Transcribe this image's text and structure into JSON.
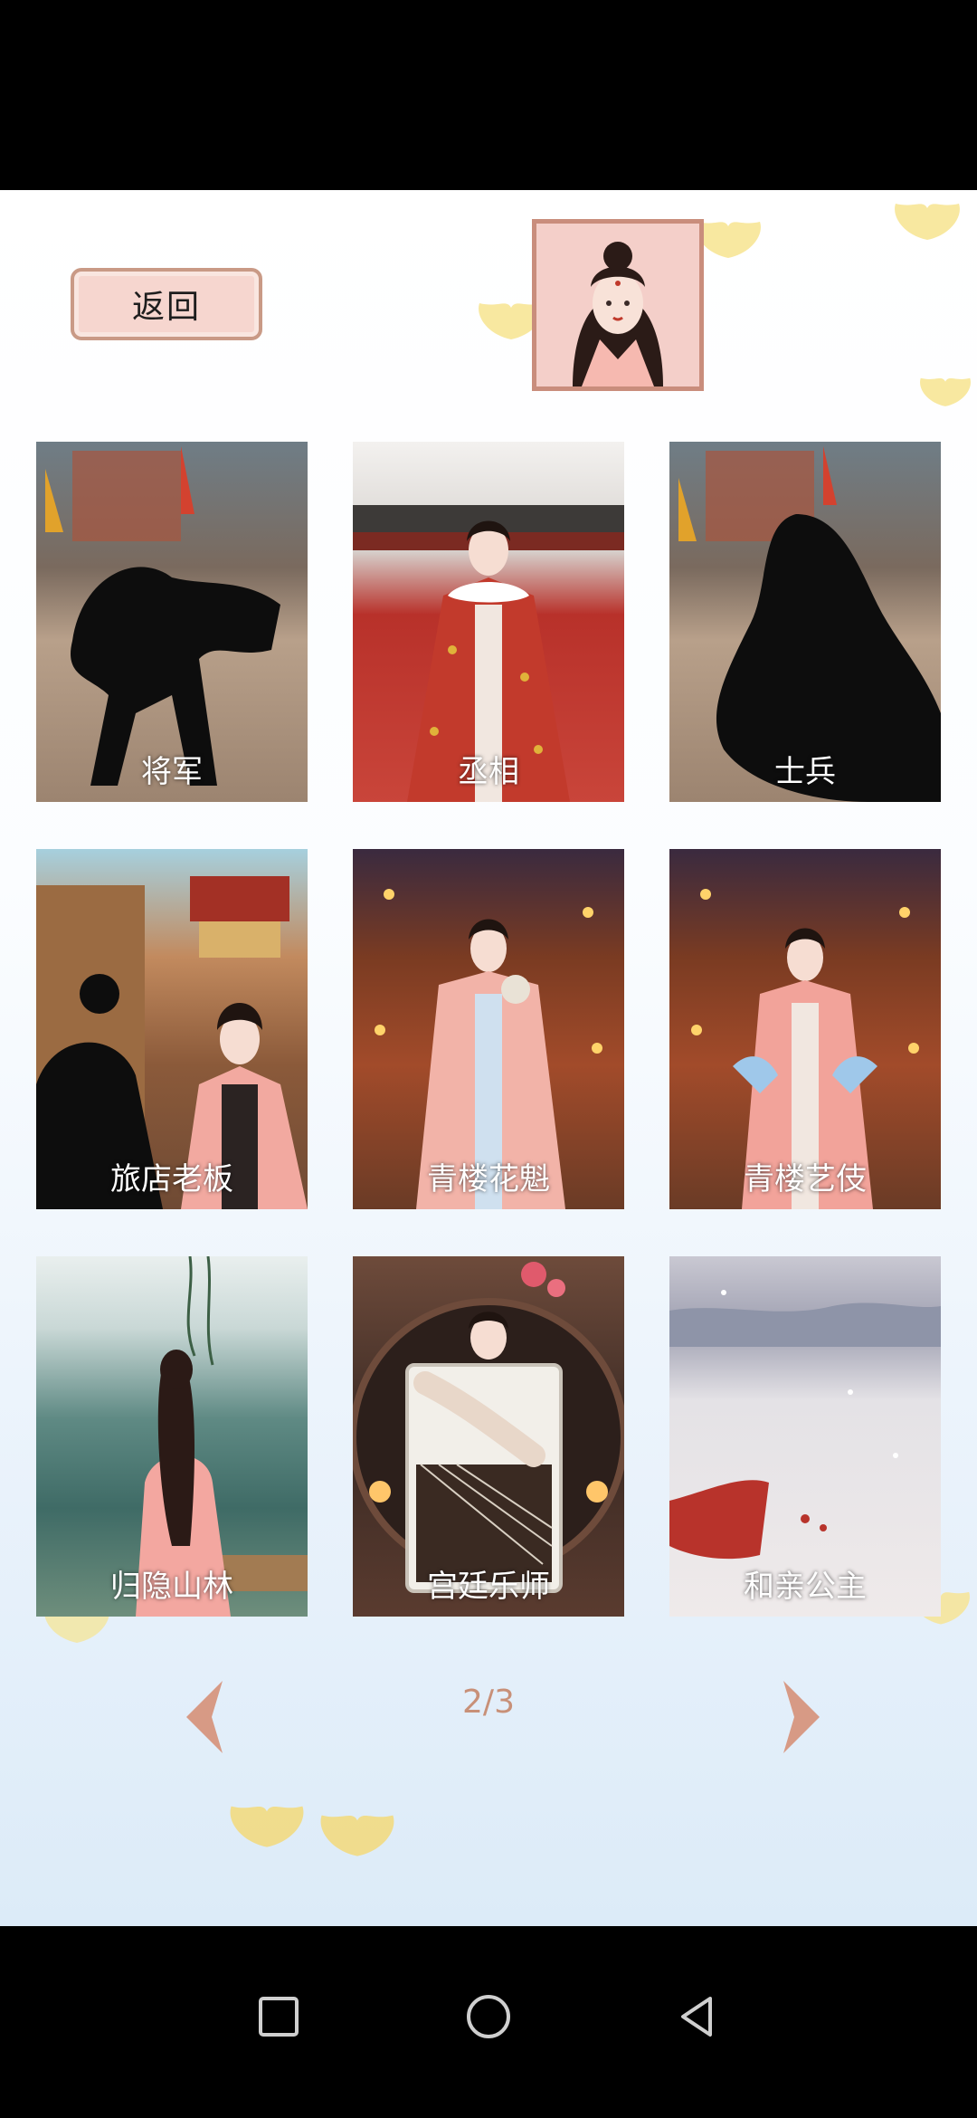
{
  "header": {
    "back_label": "返回"
  },
  "characters": [
    {
      "label": "将军"
    },
    {
      "label": "丞相"
    },
    {
      "label": "士兵"
    },
    {
      "label": "旅店老板"
    },
    {
      "label": "青楼花魁"
    },
    {
      "label": "青楼艺伎"
    },
    {
      "label": "归隐山林"
    },
    {
      "label": "宫廷乐师"
    },
    {
      "label": "和亲公主"
    }
  ],
  "pagination": {
    "indicator": "2/3",
    "prev_icon": "chevron-left-icon",
    "next_icon": "chevron-right-icon"
  },
  "system_nav": {
    "recent_icon": "square-icon",
    "home_icon": "circle-icon",
    "back_icon": "triangle-back-icon"
  },
  "colors": {
    "accent": "#c89078",
    "button_fill": "#f6d6cf",
    "button_border": "#c99a86"
  }
}
